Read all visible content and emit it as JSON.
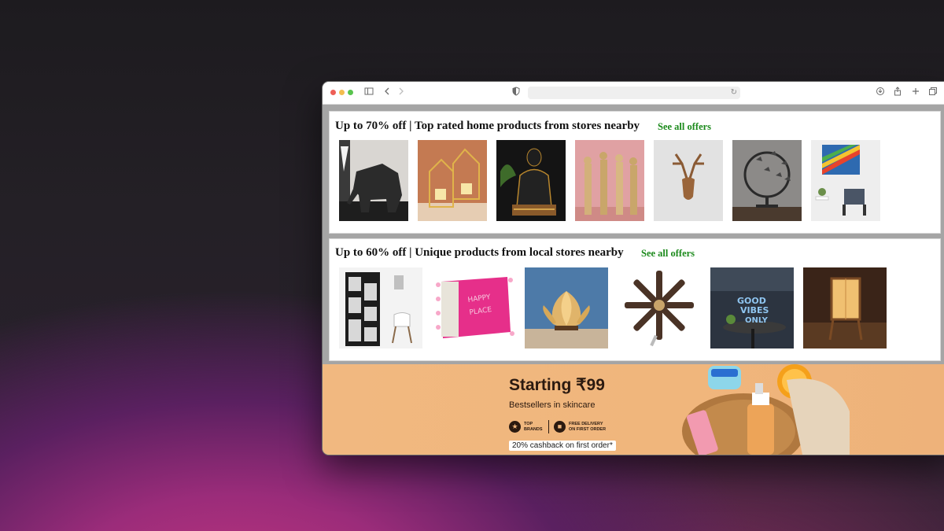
{
  "browser": {
    "address": "",
    "icons": [
      "sidebar-icon",
      "back-icon",
      "forward-icon",
      "shield-icon",
      "reload-icon",
      "download-icon",
      "share-icon",
      "new-tab-icon",
      "tabs-icon"
    ]
  },
  "sections": [
    {
      "title": "Up to 70% off | Top rated home products from stores nearby",
      "offers_label": "See all offers",
      "products": [
        "elephant-figurine",
        "gold-candle-holder",
        "buddha-statue",
        "musician-figurines",
        "deer-head-wall-decor",
        "butterfly-ring-decor",
        "abstract-canvas-art"
      ]
    },
    {
      "title": "Up to 60% off | Unique products from local stores nearby",
      "offers_label": "See all offers",
      "products": [
        "bookshelf",
        "happy-place-cushion",
        "lotus-lamp",
        "ceiling-fan",
        "good-vibes-only-sign",
        "wooden-floor-lamp"
      ]
    }
  ],
  "banner": {
    "headline": "Starting ₹99",
    "subtitle": "Bestsellers in skincare",
    "feature1_line1": "TOP",
    "feature1_line2": "BRANDS",
    "feature2_line1": "FREE DELIVERY",
    "feature2_line2": "ON FIRST ORDER",
    "cashback": "20% cashback on first order*"
  },
  "colors": {
    "offers_link": "#1c8a1c",
    "banner_bg": "#f0b67c"
  }
}
